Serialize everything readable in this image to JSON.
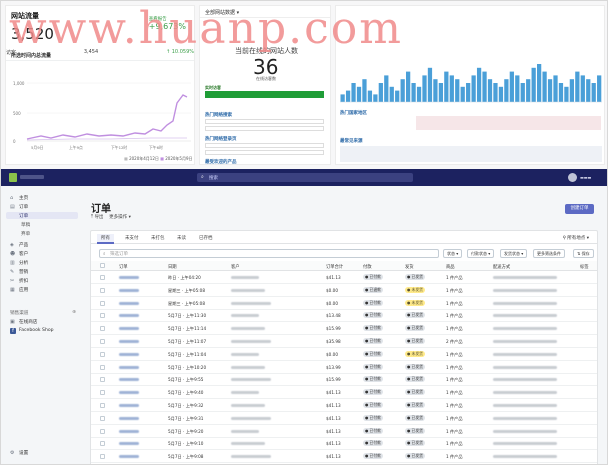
{
  "watermark": "www.huanp.com",
  "dashboard": {
    "sales": {
      "title": "网站流量",
      "big": "3,520",
      "right_label": "查看报告",
      "right_value": "+9,673%",
      "left_label": "访客",
      "mid_value": "3,454",
      "growth": "10.059%",
      "chart_title": "所选时间内总流量",
      "y_top": "1,000",
      "y_mid": "500",
      "y_zero": "0",
      "x_ticks": [
        "5月9日",
        "上午9点",
        "下午12时",
        "下午6时"
      ],
      "legend_a": "2020年4月12日",
      "legend_b": "2020年5月9日"
    },
    "live": {
      "top_label": "全部网站数据",
      "title": "当前在线的网站人数",
      "number": "36",
      "caption": "在线访客数",
      "status": "实时访客",
      "sec1": "热门网络搜索",
      "sec2": "热门网络登录页",
      "sec3": "最受欢迎的产品"
    },
    "map": {
      "link1": "热门国家地区",
      "link2": "最常见来源",
      "chart_values": [
        2,
        3,
        5,
        4,
        6,
        3,
        2,
        5,
        7,
        4,
        3,
        6,
        8,
        5,
        4,
        7,
        9,
        6,
        5,
        8,
        7,
        6,
        4,
        5,
        7,
        9,
        8,
        6,
        5,
        4,
        6,
        8,
        7,
        5,
        6,
        9,
        10,
        8,
        6,
        7,
        5,
        4,
        6,
        8,
        7,
        6,
        5,
        7
      ]
    }
  },
  "admin": {
    "search_placeholder": "搜索",
    "nav": [
      {
        "icon": "⌂",
        "label": "主页",
        "name": "nav-home"
      },
      {
        "icon": "▤",
        "label": "订单",
        "name": "nav-orders"
      },
      {
        "icon": "",
        "label": "订单",
        "name": "nav-orders-sub",
        "selected": true
      },
      {
        "icon": "",
        "label": "草稿",
        "name": "nav-drafts"
      },
      {
        "icon": "",
        "label": "弃单",
        "name": "nav-abandoned"
      },
      {
        "icon": "◈",
        "label": "产品",
        "name": "nav-products"
      },
      {
        "icon": "☻",
        "label": "客户",
        "name": "nav-customers"
      },
      {
        "icon": "▥",
        "label": "分析",
        "name": "nav-analytics"
      },
      {
        "icon": "✎",
        "label": "营销",
        "name": "nav-marketing"
      },
      {
        "icon": "✂",
        "label": "折扣",
        "name": "nav-discounts"
      },
      {
        "icon": "▦",
        "label": "应用",
        "name": "nav-apps"
      }
    ],
    "channels_label": "销售渠道",
    "channels": [
      {
        "icon": "▣",
        "label": "在线商店"
      },
      {
        "icon": "f",
        "label": "Facebook Shop"
      }
    ],
    "settings_label": "设置",
    "page_title": "订单",
    "export_label": "导出",
    "more_label": "更多操作",
    "create_button": "创建订单",
    "tabs": [
      "所有",
      "未支付",
      "未打包",
      "未读",
      "已存档"
    ],
    "location": "所有地点",
    "filter_placeholder": "筛选订单",
    "filter_buttons": [
      "状态",
      "付款状态",
      "发货状态",
      "更多筛选条件",
      "保存"
    ],
    "columns": [
      "订单",
      "日期",
      "客户",
      "订单合计",
      "付款",
      "发货",
      "商品",
      "配送方式",
      "标签"
    ],
    "rows": [
      {
        "date": "昨日 · 上午04:20",
        "total": "$41.13",
        "pay": "已付款",
        "ship": "已发货",
        "items": "1 件产品"
      },
      {
        "date": "星期三 · 上午05:08",
        "total": "$0.00",
        "pay": "已退款",
        "ship": "未发货",
        "items": "1 件产品"
      },
      {
        "date": "星期三 · 上午05:08",
        "total": "$0.00",
        "pay": "已付款",
        "ship": "未发货",
        "items": "1 件产品"
      },
      {
        "date": "5月7日 · 上午11:30",
        "total": "$13.48",
        "pay": "已付款",
        "ship": "已发货",
        "items": "1 件产品"
      },
      {
        "date": "5月7日 · 上午11:14",
        "total": "$15.99",
        "pay": "已付款",
        "ship": "已发货",
        "items": "1 件产品"
      },
      {
        "date": "5月7日 · 上午11:07",
        "total": "$35.98",
        "pay": "已付款",
        "ship": "已发货",
        "items": "2 件产品"
      },
      {
        "date": "5月7日 · 上午11:04",
        "total": "$0.00",
        "pay": "已付款",
        "ship": "未发货",
        "items": "1 件产品"
      },
      {
        "date": "5月7日 · 上午10:20",
        "total": "$13.99",
        "pay": "已付款",
        "ship": "已发货",
        "items": "1 件产品"
      },
      {
        "date": "5月7日 · 上午9:55",
        "total": "$15.99",
        "pay": "已付款",
        "ship": "已发货",
        "items": "1 件产品"
      },
      {
        "date": "5月7日 · 上午9:40",
        "total": "$41.13",
        "pay": "已付款",
        "ship": "已发货",
        "items": "1 件产品"
      },
      {
        "date": "5月7日 · 上午9:32",
        "total": "$41.13",
        "pay": "已付款",
        "ship": "已发货",
        "items": "1 件产品"
      },
      {
        "date": "5月7日 · 上午9:31",
        "total": "$41.13",
        "pay": "已付款",
        "ship": "已发货",
        "items": "1 件产品"
      },
      {
        "date": "5月7日 · 上午9:20",
        "total": "$41.13",
        "pay": "已付款",
        "ship": "已发货",
        "items": "1 件产品"
      },
      {
        "date": "5月7日 · 上午9:10",
        "total": "$41.13",
        "pay": "已付款",
        "ship": "已发货",
        "items": "1 件产品"
      },
      {
        "date": "5月7日 · 上午9:08",
        "total": "$41.13",
        "pay": "已付款",
        "ship": "已发货",
        "items": "1 件产品"
      }
    ]
  }
}
